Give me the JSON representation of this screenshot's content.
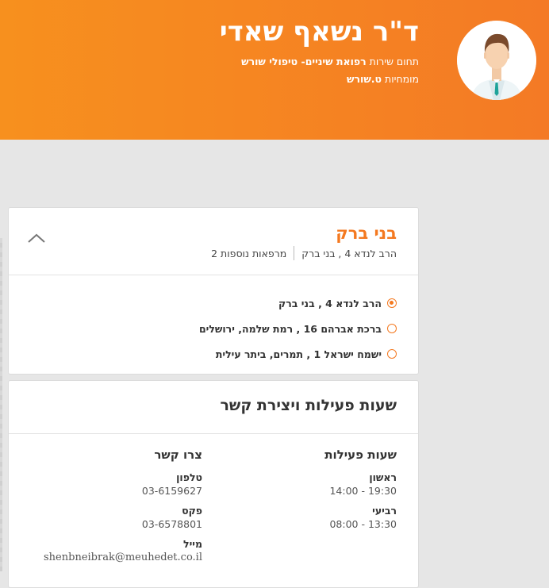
{
  "doctor": {
    "name": "ד\"ר נשאף שאדי",
    "field_prefix": "תחום שירות",
    "field_value": "רפואת שיניים- טיפולי שורש",
    "expertise_prefix": "מומחיות",
    "expertise_value": "ט.שורש"
  },
  "branch": {
    "title": "בני ברק",
    "address": "הרב לנדא 4 , בני ברק",
    "more_clinics": "מרפאות נוספות 2",
    "addresses": [
      {
        "text": "הרב לנדא 4 , בני ברק",
        "selected": true
      },
      {
        "text": "ברכת אברהם 16 , רמת שלמה, ירושלים",
        "selected": false
      },
      {
        "text": "ישמח ישראל 1 , תמרים, ביתר עילית",
        "selected": false
      }
    ]
  },
  "hours_contact": {
    "title": "שעות פעילות ויצירת קשר",
    "hours_title": "שעות פעילות",
    "days": [
      {
        "day": "ראשון",
        "time": "14:00 - 19:30"
      },
      {
        "day": "רביעי",
        "time": "08:00 - 13:30"
      }
    ],
    "contact_title": "צרו קשר",
    "phone_label": "טלפון",
    "phone": "03-6159627",
    "fax_label": "פקס",
    "fax": "03-6578801",
    "mail_label": "מייל",
    "mail": "shenbneibrak@meuhedet.co.il"
  },
  "colors": {
    "accent": "#f47920",
    "header_start": "#f7901e",
    "header_end": "#f47a25"
  }
}
